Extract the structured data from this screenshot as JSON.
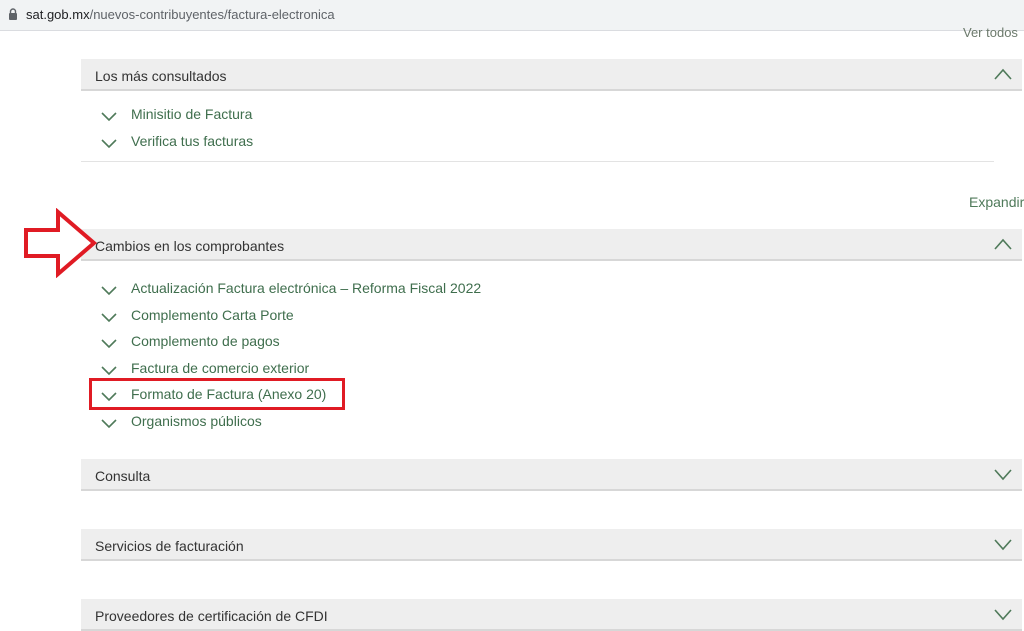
{
  "browser": {
    "url_host": "sat.gob.mx",
    "url_path": "/nuevos-contribuyentes/factura-electronica"
  },
  "top_link": "Ver todos",
  "expand_link": "Expandir",
  "sections": [
    {
      "title": "Los más consultados",
      "state": "expanded",
      "items": [
        "Minisitio de Factura",
        "Verifica tus facturas"
      ]
    },
    {
      "title": "Cambios en los comprobantes",
      "state": "expanded",
      "items": [
        "Actualización Factura electrónica – Reforma Fiscal 2022",
        "Complemento Carta Porte",
        "Complemento de pagos",
        "Factura de comercio exterior",
        "Formato de Factura (Anexo 20)",
        "Organismos públicos"
      ]
    },
    {
      "title": "Consulta",
      "state": "collapsed"
    },
    {
      "title": "Servicios de facturación",
      "state": "collapsed"
    },
    {
      "title": "Proveedores de certificación de CFDI",
      "state": "collapsed"
    }
  ],
  "colors": {
    "accent_green": "#3f6e4d",
    "header_bg": "#eeeeee",
    "annotation_red": "#e01b24"
  },
  "icons": {
    "item": "chevron-down-icon",
    "expanded": "chevron-up-icon",
    "collapsed": "chevron-down-icon"
  }
}
